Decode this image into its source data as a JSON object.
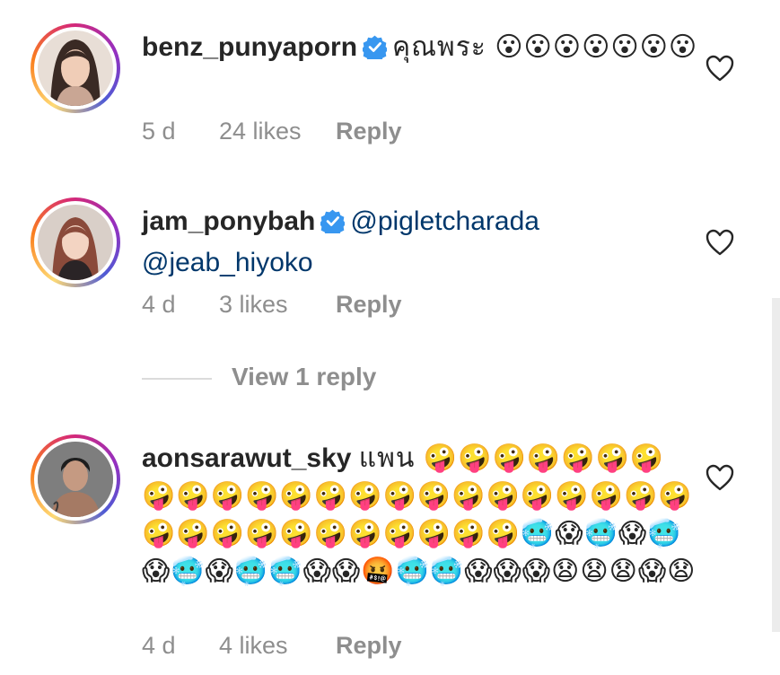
{
  "comments": [
    {
      "username": "benz_punyaporn",
      "text": "คุณพระ 😮😮😮😮😮😮😮",
      "time": "5 d",
      "likes": "24 likes",
      "reply_label": "Reply",
      "verified": true
    },
    {
      "username": "jam_ponybah",
      "mention1": "@pigletcharada",
      "mention2": "@jeab_hiyoko",
      "time": "4 d",
      "likes": "3 likes",
      "reply_label": "Reply",
      "verified": true
    },
    {
      "username": "aonsarawut_sky",
      "text": "แพน 🤪🤪🤪🤪🤪🤪🤪🤪🤪🤪🤪🤪🤪🤪🤪🤪🤪🤪🤪🤪🤪🤪🤪🤪🤪🤪🤪🤪🤪🤪🤪🤪🤪🤪🥶😱🥶😱🥶😱🥶😱🥶🥶😱😱🤬🥶🥶😱😱😱😧😧😧😱😧",
      "time": "4 d",
      "likes": "4 likes",
      "reply_label": "Reply",
      "verified": false
    }
  ],
  "view_replies": "View 1 reply",
  "colors": {
    "mention": "#00376b",
    "verified": "#3897f0",
    "meta": "#8e8e8e"
  },
  "icons": {
    "like": "heart-outline-icon",
    "verified": "verified-badge-icon"
  }
}
